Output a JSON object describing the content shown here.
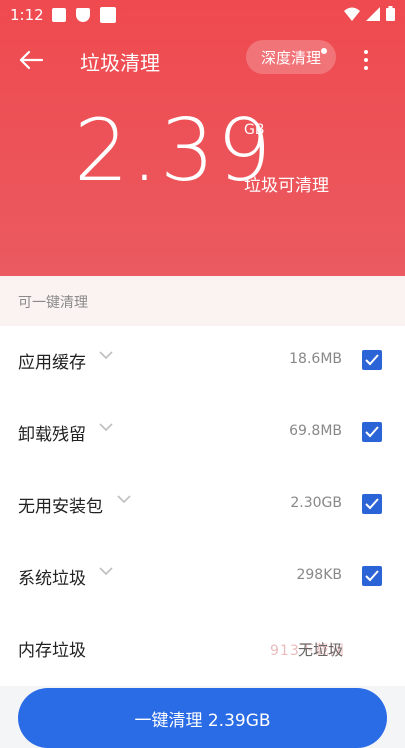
{
  "status_bar": {
    "time": "1:12"
  },
  "header": {
    "title": "垃圾清理",
    "deep_clean_label": "深度清理",
    "total_size": "2.39",
    "total_unit": "GB",
    "subtitle": "垃圾可清理",
    "accent_color": "#ef4a4f"
  },
  "section": {
    "label": "可一键清理"
  },
  "items": [
    {
      "name": "应用缓存",
      "size": "18.6MB",
      "checked": true
    },
    {
      "name": "卸载残留",
      "size": "69.8MB",
      "checked": true
    },
    {
      "name": "无用安装包",
      "size": "2.30GB",
      "checked": true
    },
    {
      "name": "系统垃圾",
      "size": "298KB",
      "checked": true
    },
    {
      "name": "内存垃圾",
      "status": "无垃圾"
    }
  ],
  "watermark": "913下载网",
  "action": {
    "label": "一键清理 2.39GB",
    "color": "#2a6be6"
  }
}
